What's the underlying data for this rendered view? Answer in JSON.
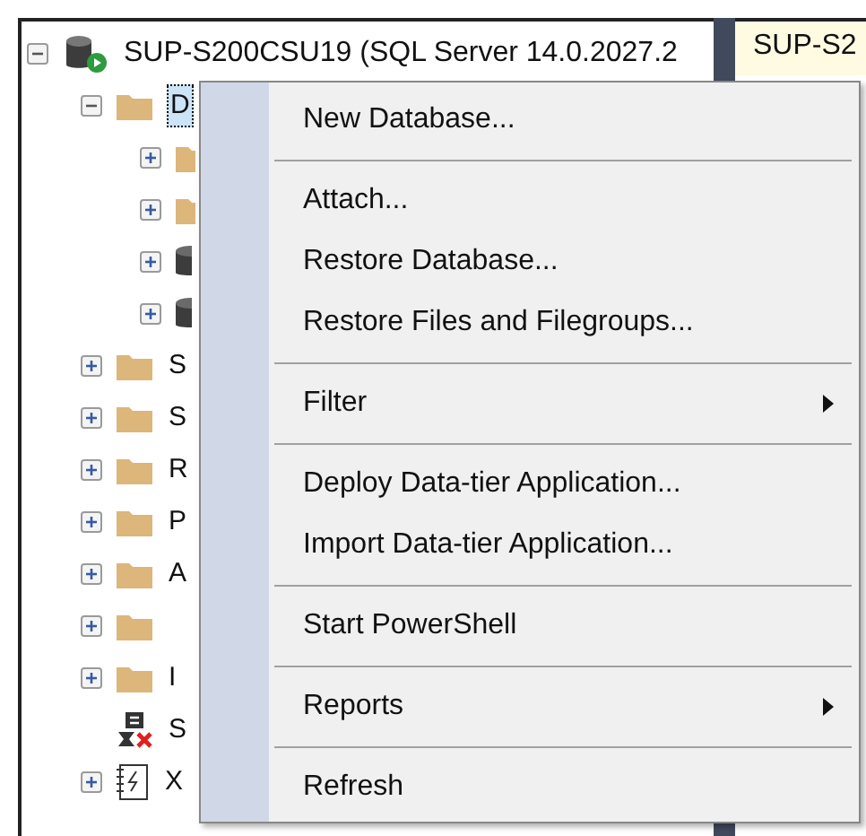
{
  "tree": {
    "label": "SUP-S200CSU19 (SQL Server 14.0.2027.2",
    "expanded": true,
    "children": [
      {
        "kind": "folder",
        "label": "D",
        "expanded": true,
        "selected": true,
        "children": [
          {
            "kind": "folder",
            "expanded": false
          },
          {
            "kind": "folder",
            "expanded": false
          },
          {
            "kind": "database",
            "expanded": false
          },
          {
            "kind": "database",
            "expanded": false
          }
        ]
      },
      {
        "kind": "folder",
        "label": "S",
        "expanded": false,
        "selected": false
      },
      {
        "kind": "folder",
        "label": "S",
        "expanded": false,
        "selected": false
      },
      {
        "kind": "folder",
        "label": "R",
        "expanded": false,
        "selected": false
      },
      {
        "kind": "folder",
        "label": "P",
        "expanded": false,
        "selected": false
      },
      {
        "kind": "folder",
        "label": "A",
        "expanded": false,
        "selected": false
      },
      {
        "kind": "folder",
        "expanded": false
      },
      {
        "kind": "folder",
        "label": "I",
        "expanded": false,
        "selected": false
      },
      {
        "kind": "agent",
        "label": "S",
        "selected": false
      },
      {
        "kind": "notebook",
        "label": "X",
        "expanded": false,
        "selected": false
      }
    ]
  },
  "document_tab": {
    "label": "SUP-S2"
  },
  "context_menu": [
    {
      "kind": "item",
      "label": "New Database...",
      "submenu": false
    },
    {
      "kind": "separator"
    },
    {
      "kind": "item",
      "label": "Attach...",
      "submenu": false
    },
    {
      "kind": "item",
      "label": "Restore Database...",
      "submenu": false
    },
    {
      "kind": "item",
      "label": "Restore Files and Filegroups...",
      "submenu": false
    },
    {
      "kind": "separator"
    },
    {
      "kind": "item",
      "label": "Filter",
      "submenu": true
    },
    {
      "kind": "separator"
    },
    {
      "kind": "item",
      "label": "Deploy Data-tier Application...",
      "submenu": false
    },
    {
      "kind": "item",
      "label": "Import Data-tier Application...",
      "submenu": false
    },
    {
      "kind": "separator"
    },
    {
      "kind": "item",
      "label": "Start PowerShell",
      "submenu": false
    },
    {
      "kind": "separator"
    },
    {
      "kind": "item",
      "label": "Reports",
      "submenu": true
    },
    {
      "kind": "separator"
    },
    {
      "kind": "item",
      "label": "Refresh",
      "submenu": false
    }
  ]
}
